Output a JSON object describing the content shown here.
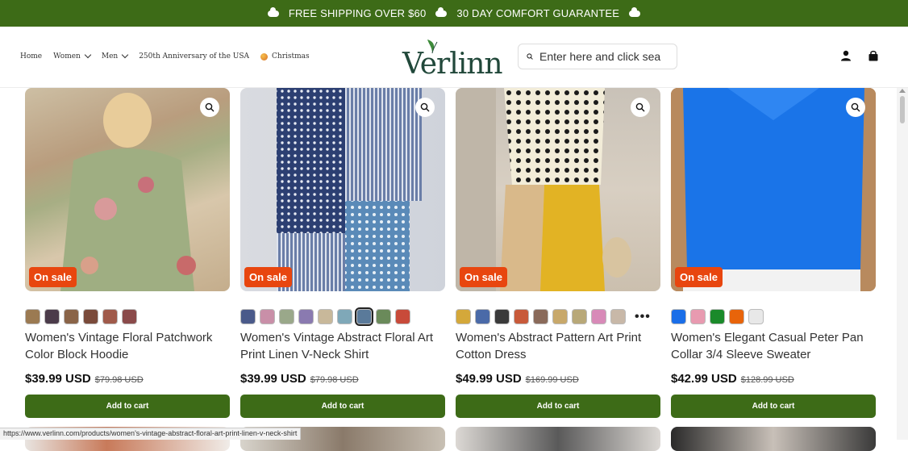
{
  "announcement": {
    "part1": "FREE SHIPPING OVER $60",
    "part2": "30 DAY COMFORT GUARANTEE"
  },
  "nav": [
    {
      "label": "Home",
      "has_dropdown": false
    },
    {
      "label": "Women",
      "has_dropdown": true
    },
    {
      "label": "Men",
      "has_dropdown": true
    },
    {
      "label": "250th Anniversary of the USA",
      "has_dropdown": false
    },
    {
      "label": "Christmas",
      "has_dropdown": false,
      "icon": "ornament-icon"
    }
  ],
  "logo": {
    "text": "Verlinn",
    "color": "#21483a"
  },
  "search": {
    "placeholder": "Enter here and click sea"
  },
  "header_icons": [
    "account-icon",
    "cart-icon"
  ],
  "colors": {
    "accent": "#3d6b17",
    "sale": "#e8460f"
  },
  "products": [
    {
      "badge": "On sale",
      "title": "Women's Vintage Floral Patchwork Color Block Hoodie",
      "price": "$39.99 USD",
      "compare_price": "$79.98 USD",
      "button": "Add to cart",
      "swatches": [
        "#9b7a52",
        "#4b3b4a",
        "#8a6448",
        "#7a4a3a",
        "#a05a4a",
        "#8a4a4a"
      ],
      "selected_swatch": -1,
      "more_swatches": false
    },
    {
      "badge": "On sale",
      "title": "Women's Vintage Abstract Floral Art Print Linen V-Neck Shirt",
      "price": "$39.99 USD",
      "compare_price": "$79.98 USD",
      "button": "Add to cart",
      "swatches": [
        "#4a5a8a",
        "#c98fa8",
        "#9aa88a",
        "#8a7ab0",
        "#c8b89a",
        "#7fa8b8",
        "#5a7a9a",
        "#6a8a5a",
        "#c84a3a"
      ],
      "selected_swatch": 6,
      "more_swatches": false
    },
    {
      "badge": "On sale",
      "title": "Women's Abstract Pattern Art Print Cotton Dress",
      "price": "$49.99 USD",
      "compare_price": "$169.99 USD",
      "button": "Add to cart",
      "swatches": [
        "#d4a83a",
        "#4a6aa8",
        "#3a3a3a",
        "#c85a3a",
        "#8a6a5a",
        "#c8a86a",
        "#b8a878",
        "#d88ab8",
        "#c8b8a8"
      ],
      "selected_swatch": -1,
      "more_swatches": true
    },
    {
      "badge": "On sale",
      "title": "Women's Elegant Casual Peter Pan Collar 3/4 Sleeve Sweater",
      "price": "$42.99 USD",
      "compare_price": "$128.99 USD",
      "button": "Add to cart",
      "swatches": [
        "#1a6ee8",
        "#e89ab0",
        "#1a8a2a",
        "#e8640a",
        "#e8e8e8"
      ],
      "selected_swatch": -1,
      "more_swatches": false
    }
  ],
  "status_url": "https://www.verlinn.com/products/women's-vintage-abstract-floral-art-print-linen-v-neck-shirt"
}
